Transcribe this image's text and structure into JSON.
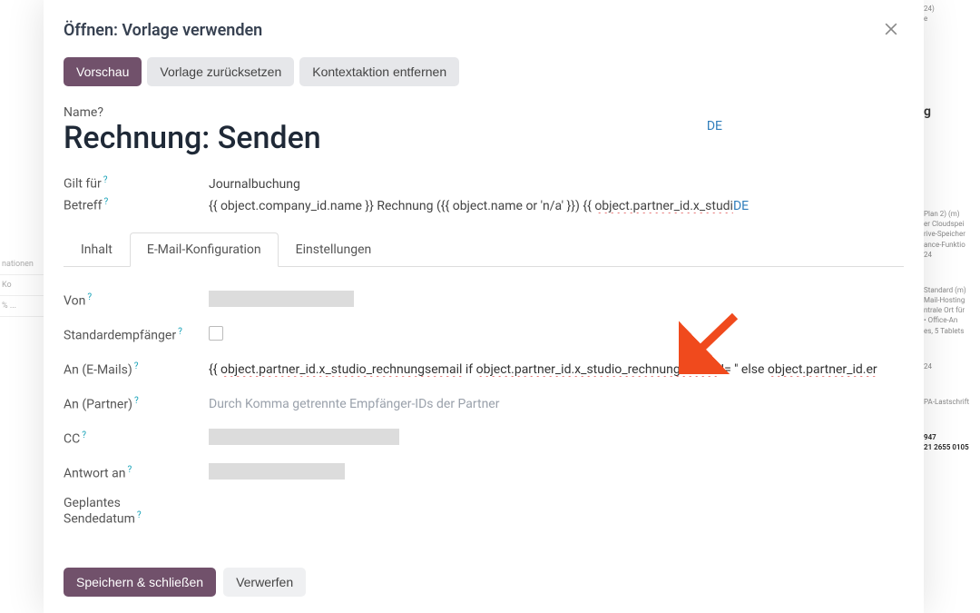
{
  "modal": {
    "title": "Öffnen: Vorlage verwenden",
    "actions": {
      "preview": "Vorschau",
      "reset": "Vorlage zurücksetzen",
      "remove_context": "Kontextaktion entfernen"
    },
    "name_label": "Name",
    "name_value": "Rechnung: Senden",
    "lang": "DE",
    "applies_to_label": "Gilt für",
    "applies_to_value": "Journalbuchung",
    "subject_label": "Betreff",
    "subject_prefix": "{{ object.company_id.name }} Rechnung ({{ object.name or 'n/a' }}) {{ ",
    "subject_expr": "object.partner_id.x_studi",
    "tabs": {
      "content": "Inhalt",
      "email_config": "E-Mail-Konfiguration",
      "settings": "Einstellungen"
    },
    "form": {
      "from_label": "Von",
      "default_to_label": "Standardempfänger",
      "to_emails_label": "An (E-Mails)",
      "to_emails_prefix": "{{ ",
      "to_emails_expr1": "object.partner_id.x_studio_rechnungsemail",
      "to_emails_mid": " if ",
      "to_emails_expr2": "object.partner_id.x_studio_rechnungsemail",
      "to_emails_suffix1": " != '' else ",
      "to_emails_expr3": "object.partner_id.er",
      "to_partners_label": "An (Partner)",
      "to_partners_placeholder": "Durch Komma getrennte Empfänger-IDs der Partner",
      "cc_label": "CC",
      "reply_to_label": "Antwort an",
      "scheduled_label_1": "Geplantes",
      "scheduled_label_2": "Sendedatum"
    },
    "footer": {
      "save": "Speichern & schließen",
      "discard": "Verwerfen"
    }
  },
  "bg_left": {
    "row1": "nationen",
    "row2": "Ko",
    "row3": "% ..."
  },
  "bg_right": {
    "l1": "24)",
    "l2": "e",
    "b1a": "Plan 2) (m)",
    "b1b": "er Cloudspei",
    "b1c": "rive-Speicher",
    "b1d": "ance-Funktio",
    "b1e": "24",
    "b2a": "Standard (m)",
    "b2b": "Mail-Hosting",
    "b2c": "ntrale Ort für",
    "b2d": "• Office-An",
    "b2e": "es, 5 Tablets",
    "b3": "24",
    "b4": "PA-Lastschrift",
    "b5a": "947",
    "b5b": "21 2655 0105"
  }
}
